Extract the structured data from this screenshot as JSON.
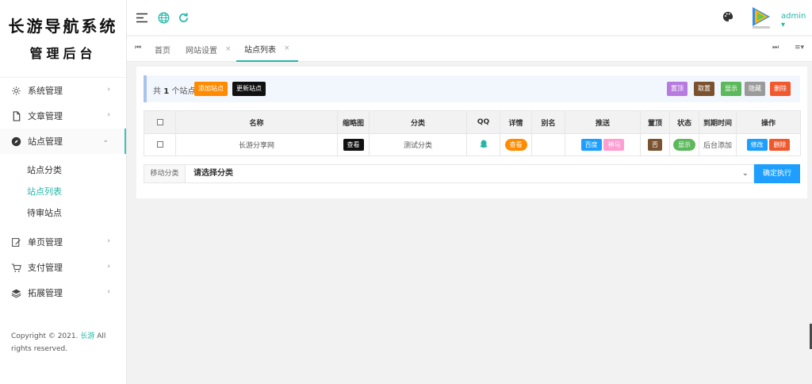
{
  "sidebar": {
    "logo_line1": "长游导航系统",
    "logo_line2": "管理后台",
    "items": [
      {
        "label": "系统管理",
        "icon": "gear-icon"
      },
      {
        "label": "文章管理",
        "icon": "document-icon"
      },
      {
        "label": "站点管理",
        "icon": "compass-icon"
      },
      {
        "label": "单页管理",
        "icon": "edit-page-icon"
      },
      {
        "label": "支付管理",
        "icon": "cart-icon"
      },
      {
        "label": "拓展管理",
        "icon": "layers-icon"
      }
    ],
    "submenu": [
      {
        "label": "站点分类"
      },
      {
        "label": "站点列表"
      },
      {
        "label": "待审站点"
      }
    ],
    "copyright_prefix": "Copyright © 2021.",
    "copyright_link": "长游",
    "copyright_suffix": "All rights reserved."
  },
  "header": {
    "user": "admin",
    "user_caret": "▾",
    "icons": [
      "menu-toggle-icon",
      "globe-icon",
      "refresh-icon",
      "palette-icon"
    ]
  },
  "tabs": {
    "prev_glyph": "⏮",
    "next_glyph": "⏭",
    "more_glyph": "≡▾",
    "close_glyph": "×",
    "items": [
      {
        "label": "首页"
      },
      {
        "label": "网站设置"
      },
      {
        "label": "站点列表"
      }
    ]
  },
  "toolbar": {
    "count_prefix": "共",
    "count_value": "1",
    "count_suffix": "个站点",
    "add_label": "添加站点",
    "update_label": "更新站点",
    "pin_label": "置顶",
    "unpin_label": "取置",
    "show_label": "显示",
    "hide_label": "隐藏",
    "delete_label": "删除"
  },
  "table": {
    "headers": [
      "名称",
      "缩略图",
      "分类",
      "QQ",
      "详情",
      "别名",
      "推送",
      "置顶",
      "状态",
      "到期时间",
      "操作"
    ],
    "rows": [
      {
        "name": "长游分享网",
        "thumb_btn": "查看",
        "category": "测试分类",
        "detail_btn": "查看",
        "alias": "",
        "push_baidu": "百度",
        "push_shenma": "神马",
        "top": "否",
        "status": "显示",
        "expire": "后台添加",
        "edit_btn": "修改",
        "delete_btn": "删除"
      }
    ]
  },
  "move": {
    "label": "移动分类",
    "select_value": "请选择分类",
    "caret": "⌄",
    "execute_label": "确定执行"
  },
  "colors": {
    "accent": "#23b7a8",
    "blue": "#1e9fff",
    "orange": "#ff8c00",
    "red": "#f0582e",
    "green": "#5cb85c",
    "purple": "#b77be0",
    "brown": "#7a5230",
    "pink": "#ff9ed2"
  }
}
